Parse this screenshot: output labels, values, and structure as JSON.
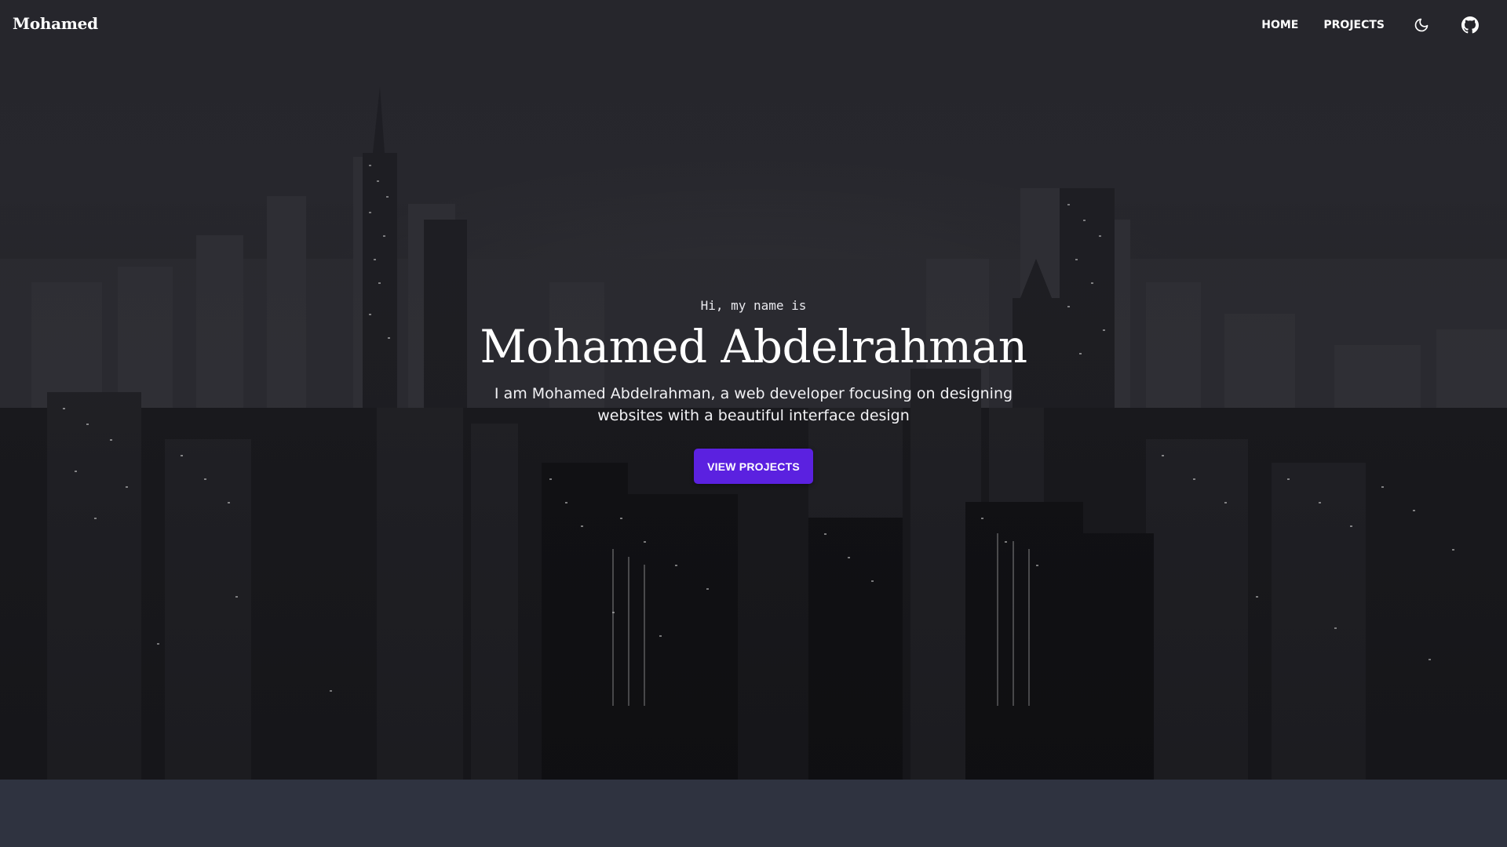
{
  "nav": {
    "brand": "Mohamed",
    "links": [
      {
        "label": "HOME"
      },
      {
        "label": "PROJECTS"
      }
    ],
    "icons": [
      "moon-icon",
      "github-icon"
    ]
  },
  "hero": {
    "greeting": "Hi, my name is",
    "name": "Mohamed Abdelrahman",
    "description": "I am Mohamed Abdelrahman, a web developer focusing on designing websites with a beautiful interface design",
    "cta_label": "VIEW PROJECTS"
  },
  "colors": {
    "accent": "#5b21e0",
    "section_bg": "#2f3340",
    "text": "#ffffff"
  }
}
